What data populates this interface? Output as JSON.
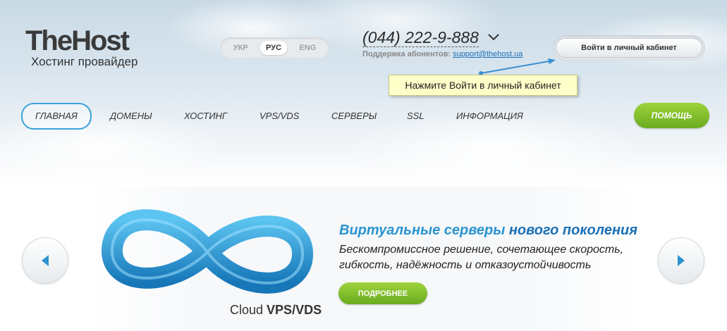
{
  "header": {
    "logo_main": "TheHost",
    "logo_sub": "Хостинг провайдер",
    "languages": [
      {
        "label": "УКР",
        "active": false
      },
      {
        "label": "РУС",
        "active": true
      },
      {
        "label": "ENG",
        "active": false
      }
    ],
    "phone": "(044) 222-9-888",
    "support_label": "Поддержка абонентов:",
    "support_email": "support@thehost.ua",
    "login_button": "Войти в личный кабинет",
    "tooltip": "Нажмите Войти в личный кабинет"
  },
  "nav": {
    "items": [
      {
        "label": "ГЛАВНАЯ",
        "active": true
      },
      {
        "label": "ДОМЕНЫ",
        "active": false
      },
      {
        "label": "ХОСТИНГ",
        "active": false
      },
      {
        "label": "VPS/VDS",
        "active": false
      },
      {
        "label": "СЕРВЕРЫ",
        "active": false
      },
      {
        "label": "SSL",
        "active": false
      },
      {
        "label": "ИНФОРМАЦИЯ",
        "active": false
      }
    ],
    "help_button": "ПОМОЩЬ"
  },
  "slider": {
    "cloud_prefix": "Cloud",
    "cloud_suffix": "VPS/VDS",
    "title_part1": "Виртуальные серверы",
    "title_part2": "нового поколения",
    "text": "Бескомпромиссное решение, сочетающее скорость, гибкость, надёжность и отказоустойчивость",
    "more_button": "ПОДРОБНЕЕ",
    "prev_icon": "arrow-left-icon",
    "next_icon": "arrow-right-icon"
  },
  "colors": {
    "accent_blue": "#2a93d0",
    "brand_green": "#7dbf28",
    "tooltip_bg": "#fefec8"
  }
}
